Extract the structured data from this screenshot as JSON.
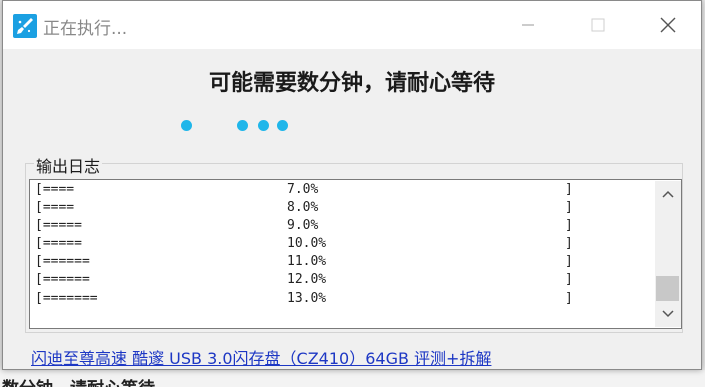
{
  "window": {
    "title": "正在执行...",
    "icon": "brush-app-icon",
    "controls": [
      "minimize-icon",
      "maximize-icon",
      "close-icon"
    ]
  },
  "headline": "可能需要数分钟，请耐心等待",
  "progress_dots": {
    "count": 4,
    "color": "#1fb6ea"
  },
  "log": {
    "label": "输出日志",
    "lines": [
      {
        "bar": "[====",
        "percent": "7.0%",
        "end": "]"
      },
      {
        "bar": "[====",
        "percent": "8.0%",
        "end": "]"
      },
      {
        "bar": "[=====",
        "percent": "9.0%",
        "end": "]"
      },
      {
        "bar": "[=====",
        "percent": "10.0%",
        "end": "]"
      },
      {
        "bar": "[======",
        "percent": "11.0%",
        "end": "]"
      },
      {
        "bar": "[======",
        "percent": "12.0%",
        "end": "]"
      },
      {
        "bar": "[=======",
        "percent": "13.0%",
        "end": "]"
      }
    ],
    "scroll_position": "bottom"
  },
  "footer_link": "闪迪至尊高速 酷邃 USB 3.0闪存盘（CZ410）64GB 评测+拆解",
  "background_window_text": "数分钟，请耐心等待",
  "colors": {
    "accent": "#1fb6ea",
    "link": "#1d37c4",
    "icon_bg": "#1ba0e2"
  }
}
